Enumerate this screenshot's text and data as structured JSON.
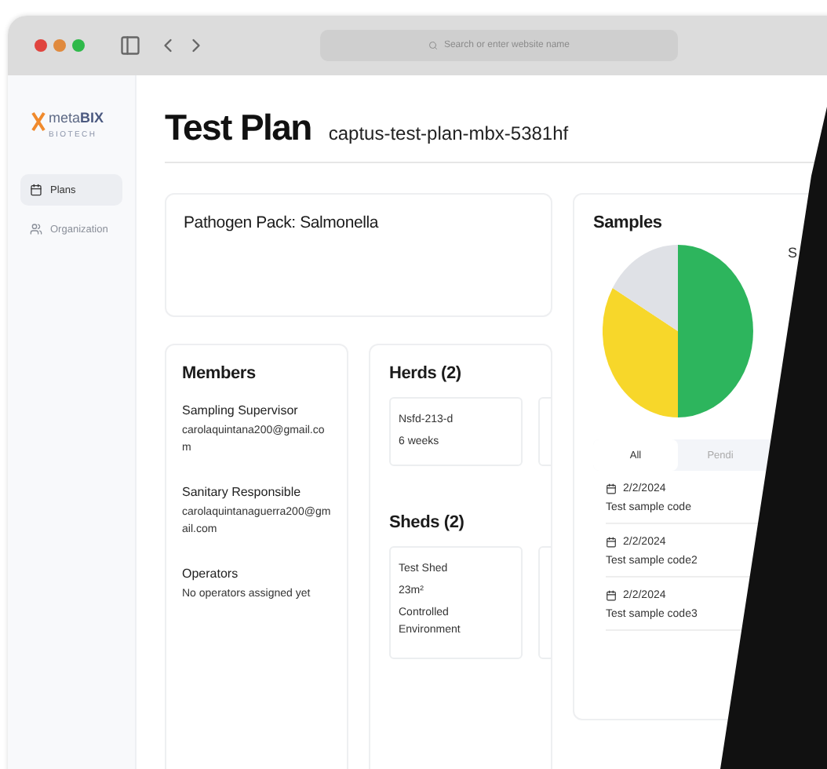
{
  "browser": {
    "address_placeholder": "Search or enter website name"
  },
  "sidebar": {
    "logo": {
      "word": "meta",
      "word_bold": "BIX",
      "tagline": "BIOTECH"
    },
    "items": [
      {
        "label": "Plans",
        "selected": true
      },
      {
        "label": "Organization",
        "selected": false
      }
    ]
  },
  "header": {
    "title": "Test Plan",
    "subtitle": "captus-test-plan-mbx-5381hf"
  },
  "pathogen": {
    "label": "Pathogen Pack:",
    "value": "Salmonella"
  },
  "members": {
    "title": "Members",
    "groups": [
      {
        "role": "Sampling Supervisor",
        "value": "carolaquintana200@gmail.com"
      },
      {
        "role": "Sanitary Responsible",
        "value": "carolaquintanaguerra200@gmail.com"
      },
      {
        "role": "Operators",
        "value": "No operators assigned yet"
      }
    ]
  },
  "herds": {
    "title": "Herds (2)",
    "items": [
      {
        "kind": "full",
        "lines": [
          "Nsfd-213-d",
          "6 weeks"
        ]
      },
      {
        "kind": "cut"
      }
    ]
  },
  "sheds": {
    "title": "Sheds (2)",
    "items": [
      {
        "kind": "full",
        "lines": [
          "Test Shed",
          "23m²",
          "Controlled Environment"
        ]
      },
      {
        "kind": "cut"
      }
    ]
  },
  "samples": {
    "title": "Samples",
    "legend_label": "S",
    "tabs": [
      {
        "label": "All",
        "selected": true
      },
      {
        "label": "Pendi",
        "selected": false
      }
    ],
    "rows": [
      {
        "date": "2/2/2024",
        "code": "Test sample code"
      },
      {
        "date": "2/2/2024",
        "code": "Test sample code2"
      },
      {
        "date": "2/2/2024",
        "code": "Test sample code3"
      }
    ]
  }
}
